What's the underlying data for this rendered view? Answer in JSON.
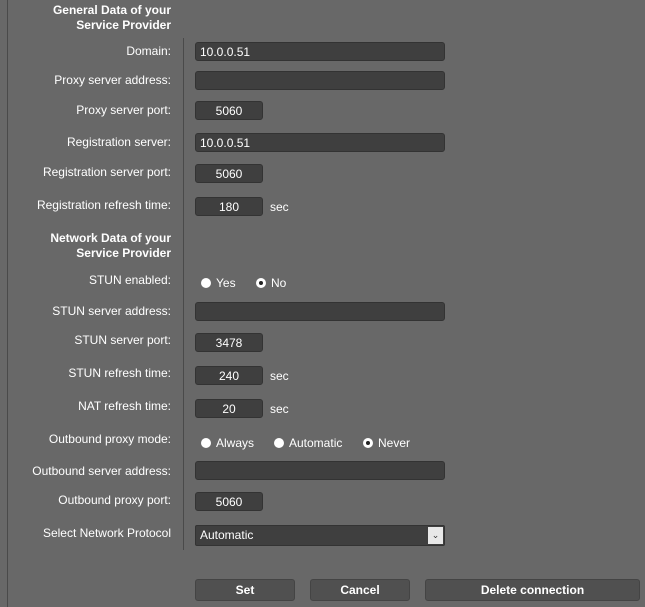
{
  "general": {
    "title_line1": "General Data of your",
    "title_line2": "Service Provider",
    "domain_label": "Domain:",
    "domain": "10.0.0.51",
    "proxy_address_label": "Proxy server address:",
    "proxy_address": "",
    "proxy_port_label": "Proxy server port:",
    "proxy_port": "5060",
    "reg_server_label": "Registration server:",
    "reg_server": "10.0.0.51",
    "reg_port_label": "Registration server port:",
    "reg_port": "5060",
    "reg_refresh_label": "Registration refresh time:",
    "reg_refresh": "180",
    "unit": "sec"
  },
  "network": {
    "title_line1": "Network Data of your",
    "title_line2": "Service Provider",
    "stun_enabled_label": "STUN enabled:",
    "yes": "Yes",
    "no": "No",
    "stun_enabled": "No",
    "stun_address_label": "STUN server address:",
    "stun_address": "",
    "stun_port_label": "STUN server port:",
    "stun_port": "3478",
    "stun_refresh_label": "STUN refresh time:",
    "stun_refresh": "240",
    "nat_refresh_label": "NAT refresh time:",
    "nat_refresh": "20",
    "unit": "sec",
    "outbound_mode_label": "Outbound proxy mode:",
    "always": "Always",
    "automatic": "Automatic",
    "never": "Never",
    "outbound_mode": "Never",
    "outbound_address_label": "Outbound server address:",
    "outbound_address": "",
    "outbound_port_label": "Outbound proxy port:",
    "outbound_port": "5060",
    "protocol_label": "Select Network Protocol",
    "protocol": "Automatic"
  },
  "buttons": {
    "set": "Set",
    "cancel": "Cancel",
    "delete": "Delete connection"
  }
}
